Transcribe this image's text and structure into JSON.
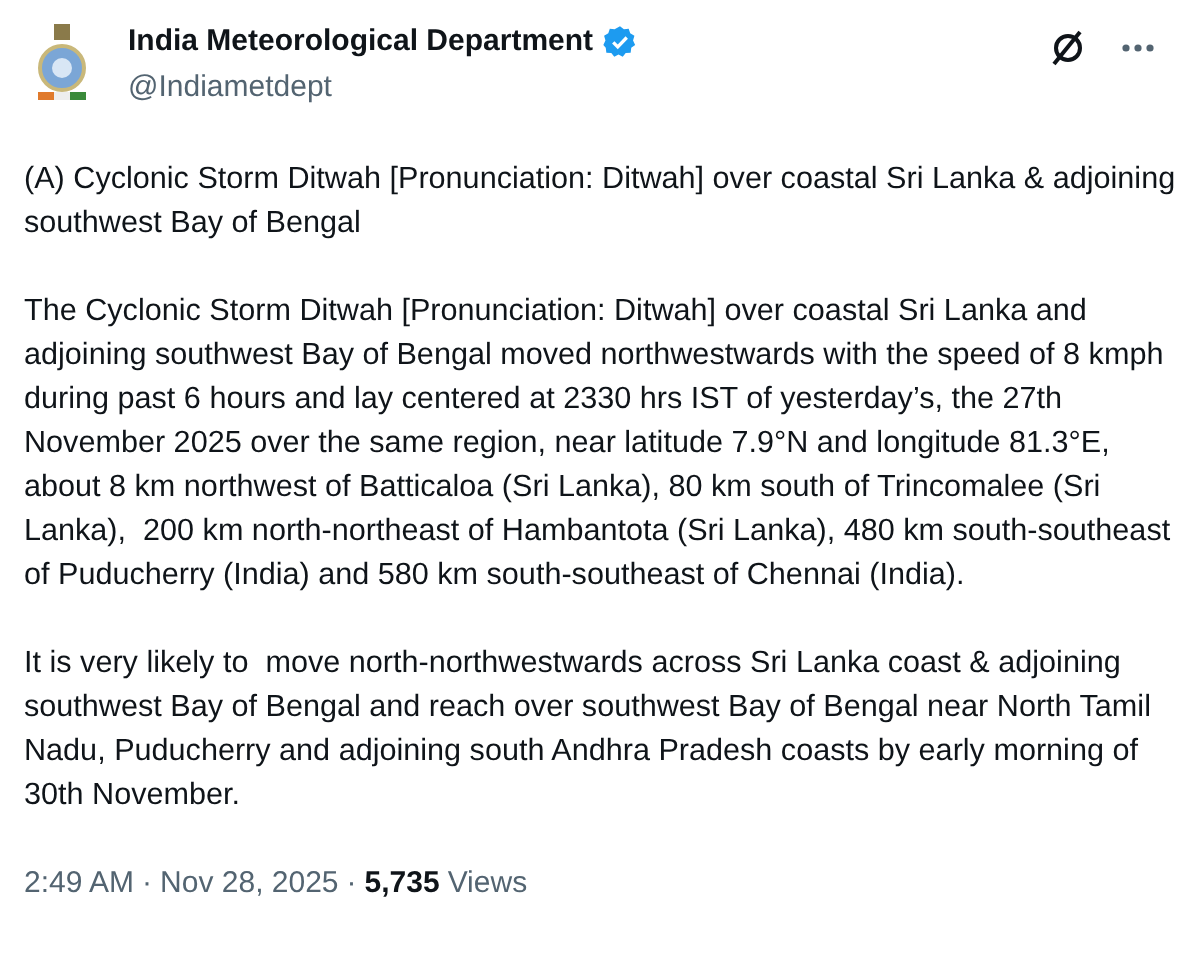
{
  "author": {
    "name": "India Meteorological Department",
    "verified": true,
    "handle": "@Indiametdept"
  },
  "paragraphs": [
    "(A) Cyclonic Storm Ditwah [Pronunciation: Ditwah] over coastal Sri Lanka & adjoining southwest Bay of Bengal",
    "The Cyclonic Storm Ditwah [Pronunciation: Ditwah] over coastal Sri Lanka and adjoining southwest Bay of Bengal moved northwestwards with the speed of 8 kmph during past 6 hours and lay centered at 2330 hrs IST of yesterday’s, the 27th November 2025 over the same region, near latitude 7.9°N and longitude 81.3°E, about 8 km northwest of Batticaloa (Sri Lanka), 80 km south of Trincomalee (Sri Lanka),  200 km north-northeast of Hambantota (Sri Lanka), 480 km south-southeast of Puducherry (India) and 580 km south-southeast of Chennai (India).",
    "It is very likely to  move north-northwestwards across Sri Lanka coast & adjoining southwest Bay of Bengal and reach over southwest Bay of Bengal near North Tamil Nadu, Puducherry and adjoining south Andhra Pradesh coasts by early morning of 30th November."
  ],
  "footer": {
    "time": "2:49 AM",
    "separator_1": "·",
    "date": "Nov 28, 2025",
    "separator_2": "·",
    "views_count": "5,735",
    "views_label": "Views"
  }
}
